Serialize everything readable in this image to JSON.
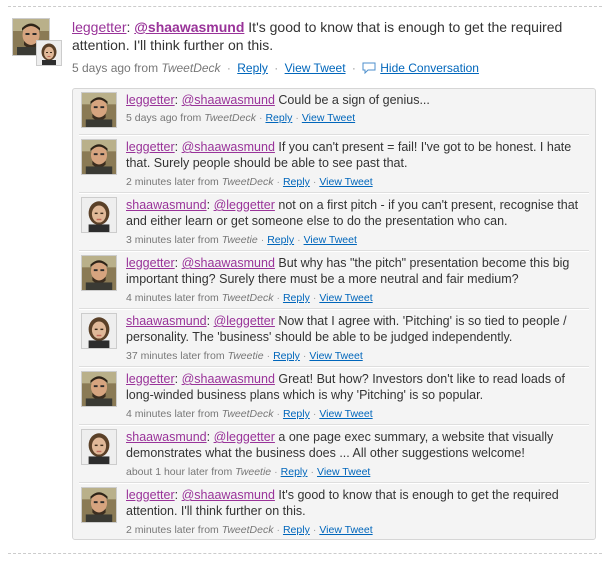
{
  "main": {
    "user": "leggetter",
    "mention": "@shaawasmund",
    "text": "It's good to know that is enough to get the required attention. I'll think further on this.",
    "time": "5 days ago",
    "from_word": "from",
    "source": "TweetDeck",
    "reply_label": "Reply",
    "view_label": "View Tweet",
    "hide_label": "Hide Conversation"
  },
  "conversation": [
    {
      "user": "leggetter",
      "mention": "@shaawasmund",
      "text": "Could be a sign of genius...",
      "time": "5 days ago",
      "from_word": "from",
      "source": "TweetDeck",
      "reply_label": "Reply",
      "view_label": "View Tweet",
      "avatar": "man-avatar"
    },
    {
      "user": "leggetter",
      "mention": "@shaawasmund",
      "text": "If you can't present = fail! I've got to be honest. I hate that. Surely people should be able to see past that.",
      "time": "2 minutes later",
      "from_word": "from",
      "source": "TweetDeck",
      "reply_label": "Reply",
      "view_label": "View Tweet",
      "avatar": "man-avatar"
    },
    {
      "user": "shaawasmund",
      "mention": "@leggetter",
      "text": "not on a first pitch - if you can't present, recognise that and either learn or get someone else to do the presentation who can.",
      "time": "3 minutes later",
      "from_word": "from",
      "source": "Tweetie",
      "reply_label": "Reply",
      "view_label": "View Tweet",
      "avatar": "woman-avatar"
    },
    {
      "user": "leggetter",
      "mention": "@shaawasmund",
      "text": "But why has \"the pitch\" presentation become this big important thing? Surely there must be a more neutral and fair medium?",
      "time": "4 minutes later",
      "from_word": "from",
      "source": "TweetDeck",
      "reply_label": "Reply",
      "view_label": "View Tweet",
      "avatar": "man-avatar"
    },
    {
      "user": "shaawasmund",
      "mention": "@leggetter",
      "text": "Now that I agree with. 'Pitching' is so tied to people / personality. The 'business' should be able to be judged independently.",
      "time": "37 minutes later",
      "from_word": "from",
      "source": "Tweetie",
      "reply_label": "Reply",
      "view_label": "View Tweet",
      "avatar": "woman-avatar"
    },
    {
      "user": "leggetter",
      "mention": "@shaawasmund",
      "text": "Great! But how? Investors don't like to read loads of long-winded business plans which is why 'Pitching' is so popular.",
      "time": "4 minutes later",
      "from_word": "from",
      "source": "TweetDeck",
      "reply_label": "Reply",
      "view_label": "View Tweet",
      "avatar": "man-avatar"
    },
    {
      "user": "shaawasmund",
      "mention": "@leggetter",
      "text": "a one page exec summary, a website that visually demonstrates what the business does ... All other suggestions welcome!",
      "time": "about 1 hour later",
      "from_word": "from",
      "source": "Tweetie",
      "reply_label": "Reply",
      "view_label": "View Tweet",
      "avatar": "woman-avatar"
    },
    {
      "user": "leggetter",
      "mention": "@shaawasmund",
      "text": "It's good to know that is enough to get the required attention. I'll think further on this.",
      "time": "2 minutes later",
      "from_word": "from",
      "source": "TweetDeck",
      "reply_label": "Reply",
      "view_label": "View Tweet",
      "avatar": "man-avatar"
    }
  ]
}
